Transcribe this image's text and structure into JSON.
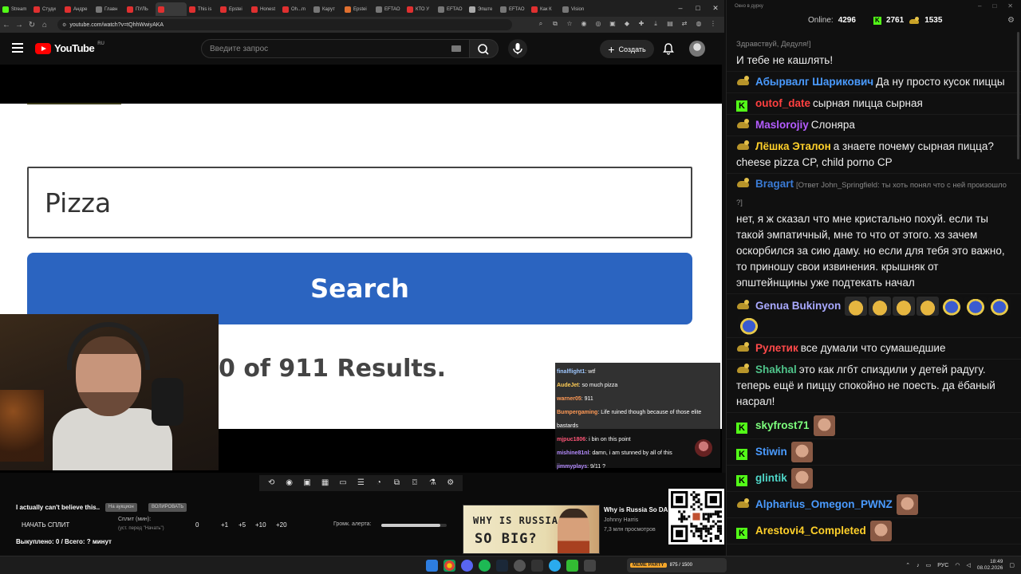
{
  "browser": {
    "tabs": [
      {
        "label": "Stream",
        "color": "#53fc18"
      },
      {
        "label": "Студи",
        "color": "#e03030"
      },
      {
        "label": "Андре",
        "color": "#e03030"
      },
      {
        "label": "Главн",
        "color": "#777777"
      },
      {
        "label": "ПУЛЬ",
        "color": "#e03030"
      },
      {
        "label": "",
        "color": "#e03030",
        "active": true
      },
      {
        "label": "This is",
        "color": "#e03030"
      },
      {
        "label": "Epstei",
        "color": "#e03030"
      },
      {
        "label": "Honest",
        "color": "#e03030"
      },
      {
        "label": "Oh...m",
        "color": "#e03030"
      },
      {
        "label": "Карут",
        "color": "#777777"
      },
      {
        "label": "Epstei",
        "color": "#e07030"
      },
      {
        "label": "EFTAO",
        "color": "#777777"
      },
      {
        "label": "КТО У",
        "color": "#e03030"
      },
      {
        "label": "EFTAO",
        "color": "#777777"
      },
      {
        "label": "Эпште",
        "color": "#aaaaaa"
      },
      {
        "label": "EFTAO",
        "color": "#777777"
      },
      {
        "label": "Как К",
        "color": "#e03030"
      },
      {
        "label": "Vision",
        "color": "#777777"
      }
    ],
    "url": "youtube.com/watch?v=tQhhWwiyAKA"
  },
  "youtube": {
    "logo_text": "YouTube",
    "region": "RU",
    "search_placeholder": "Введите запрос",
    "create_label": "Создать"
  },
  "video": {
    "search_value": "Pizza",
    "search_button": "Search",
    "results_text": "0 of 911 Results.",
    "overlay_chat": [
      {
        "user": "finalflight1",
        "text": "wtf",
        "color": "#9ec7ff"
      },
      {
        "user": "AudeJet",
        "text": "so much pizza",
        "color": "#ffcc55"
      },
      {
        "user": "warner05",
        "text": "911",
        "color": "#ff9955"
      },
      {
        "user": "Bumpergaming",
        "text": "Life ruined though because of those elite bastards",
        "color": "#ff9955"
      },
      {
        "user": "mjpuc1806",
        "text": "i bin on this point",
        "color": "#ff5577"
      },
      {
        "user": "mishine81nl",
        "text": "damn, i am stunned by all of this",
        "color": "#b58cff"
      },
      {
        "user": "jimmyplays",
        "text": "9/11 ?",
        "color": "#b58cff"
      }
    ]
  },
  "lower": {
    "title": "I actually can't believe this..",
    "chip1": "На аукцион",
    "chip2": "ВОЛИРОВАТЬ",
    "split_button": "НАЧАТЬ СПЛИТ",
    "split_label": "Сплит (мин):",
    "split_sub": "(уст. перед \"Начать\")",
    "split_values": [
      "0",
      "+1",
      "+5",
      "+10",
      "+20"
    ],
    "volume_label": "Громк. алерта:",
    "volume_level": 0.9,
    "bought": "Выкуплено: 0 / Всего: ? минут",
    "rec_title": "Why is Russia So DA",
    "rec_channel": "Johnny Harris",
    "rec_views": "7,3 млн просмотров",
    "rec_thumb_line1": "WHY IS RUSSIA",
    "rec_thumb_line2": "SO BIG?"
  },
  "chat": {
    "window_title": "Окно в дурку",
    "online_label": "Online:",
    "online_value": "4296",
    "kick_value": "2761",
    "duck_value": "1535",
    "messages": [
      {
        "badge": "",
        "user": "",
        "color": "#fff",
        "reply": "Здравствуй, Дедуля!]",
        "text": "И тебе не кашлять!"
      },
      {
        "badge": "duck",
        "user": "Абырвалг Шарикович",
        "color": "#4a9bff",
        "reply": "",
        "text": "Да ну просто кусок пиццы"
      },
      {
        "badge": "kick",
        "user": "outof_date",
        "color": "#ff4040",
        "reply": "",
        "text": "сырная пицца сырная"
      },
      {
        "badge": "duck",
        "user": "Maslorojiy",
        "color": "#b45cff",
        "reply": "",
        "text": "Слоняра"
      },
      {
        "badge": "duck",
        "user": "Лёшка Эталон",
        "color": "#ffd02a",
        "reply": "",
        "text": "а знаете почему сырная пицца? cheese pizza CP, child porno CP"
      },
      {
        "badge": "duck",
        "user": "Bragart",
        "color": "#3a7bd5",
        "reply": "[Ответ John_Springfield: ты хоть понял что с ней произошло ?]",
        "text": "нет, я ж сказал что мне кристально похуй. если ты такой эмпатичный, мне то что от этого. хз зачем оскорбился за сию даму. но если для тебя это важно, то приношу свои извинения. крышняк от эпштейнщины уже подтекать начал"
      },
      {
        "badge": "duck",
        "user": "Genua Bukinyon",
        "color": "#a9a9ff",
        "reply": "",
        "text": "",
        "emotes": [
          "bread",
          "bread",
          "bread",
          "bread",
          "blue",
          "blue",
          "blue",
          "blue"
        ]
      },
      {
        "badge": "duck",
        "user": "Рулетик",
        "color": "#ff4a4a",
        "reply": "",
        "text": "все думали что сумашедшие"
      },
      {
        "badge": "duck",
        "user": "Shakhal",
        "color": "#4fc38a",
        "reply": "",
        "text": "это как лгбт спиздили у детей радугу. теперь ещё и пиццу спокойно не поесть. да ёбаный насрал!"
      },
      {
        "badge": "kick",
        "user": "skyfrost71",
        "color": "#7dff7d",
        "reply": "",
        "text": "",
        "emotes": [
          "face"
        ]
      },
      {
        "badge": "kick",
        "user": "Stiwin",
        "color": "#4a9bff",
        "reply": "",
        "text": "",
        "emotes": [
          "face"
        ]
      },
      {
        "badge": "kick",
        "user": "glintik",
        "color": "#4fd6c8",
        "reply": "",
        "text": "",
        "emotes": [
          "face"
        ]
      },
      {
        "badge": "duck",
        "user": "Alpharius_Omegon_PWNZ",
        "color": "#4a9bff",
        "reply": "",
        "text": "",
        "emotes": [
          "face"
        ]
      },
      {
        "badge": "kick",
        "user": "Arestovi4_Completed",
        "color": "#ffd02a",
        "reply": "",
        "text": "",
        "emotes": [
          "face"
        ]
      }
    ]
  },
  "taskbar": {
    "app_label": "MEME PARTY",
    "app_value": "875 / 1500",
    "lang": "РУС",
    "time": "18:49",
    "date": "08.02.2026"
  },
  "colors": {
    "kick_green": "#53fc18",
    "search_blue": "#2b64c0",
    "youtube_red": "#ff0000"
  }
}
